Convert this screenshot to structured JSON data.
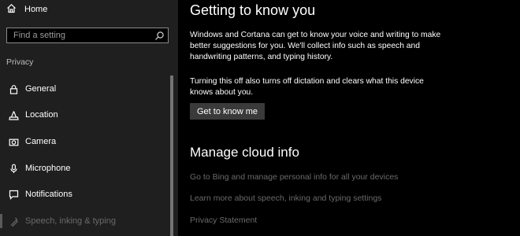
{
  "sidebar": {
    "home": {
      "label": "Home",
      "icon": "home-icon"
    },
    "search": {
      "placeholder": "Find a setting",
      "value": "",
      "icon": "search-icon"
    },
    "section_label": "Privacy",
    "items": [
      {
        "label": "General",
        "icon": "lock-icon",
        "active": false
      },
      {
        "label": "Location",
        "icon": "location-icon",
        "active": false
      },
      {
        "label": "Camera",
        "icon": "camera-icon",
        "active": false
      },
      {
        "label": "Microphone",
        "icon": "microphone-icon",
        "active": false
      },
      {
        "label": "Notifications",
        "icon": "notifications-icon",
        "active": false
      },
      {
        "label": "Speech, inking & typing",
        "icon": "speech-icon",
        "active": true
      }
    ]
  },
  "main": {
    "title": "Getting to know you",
    "description": "Windows and Cortana can get to know your voice and writing to make better suggestions for you. We'll collect info such as speech and handwriting patterns, and typing history.",
    "notice": "Turning this off also turns off dictation and clears what this device knows about you.",
    "button_label": "Get to know me",
    "section_title": "Manage cloud info",
    "links": [
      "Go to Bing and manage personal info for all your devices",
      "Learn more about speech, inking and typing settings",
      "Privacy Statement"
    ]
  },
  "colors": {
    "background": "#000000",
    "sidebar_background": "#1f1f1f",
    "button_background": "#3a3a3a",
    "link_text": "#6a6a6a",
    "text": "#ffffff"
  }
}
